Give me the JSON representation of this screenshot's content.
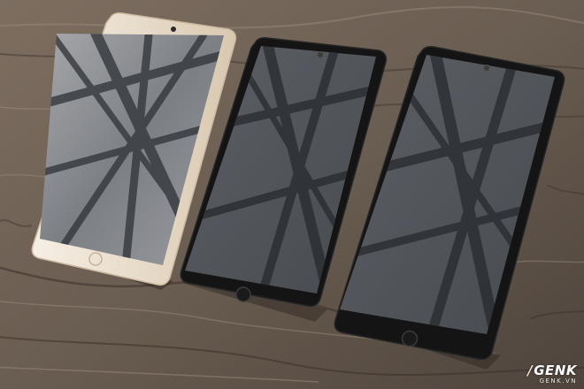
{
  "photo": {
    "subject": "three-smartphones-on-wooden-table",
    "colors": {
      "wood_light": "#8a7a6b",
      "wood_dark": "#4a4039",
      "gold_phone_body": "#efe6d8",
      "black_phone_body": "#141414",
      "screen": "#4d5156"
    }
  },
  "watermark": {
    "logo_prefix": "/",
    "logo_text": "GENK",
    "subtext": "GENK.VN"
  }
}
